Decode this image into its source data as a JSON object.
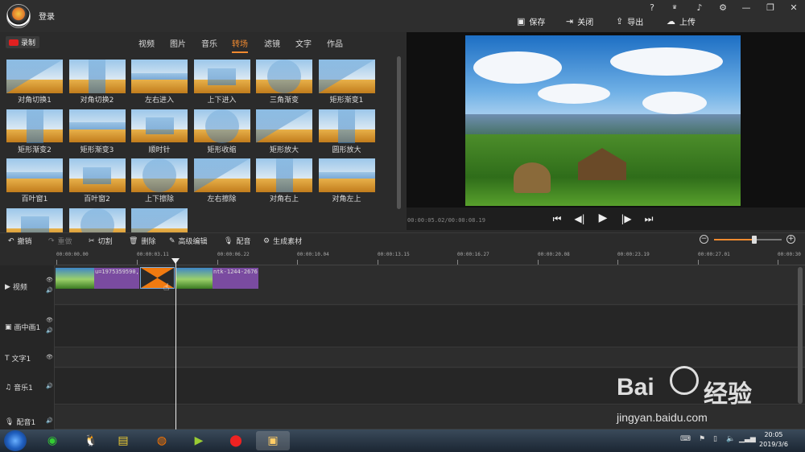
{
  "titlebar": {
    "login": "登录",
    "top_icons": [
      "?",
      "VIP",
      "bell",
      "gear",
      "—",
      "❐",
      "✕"
    ],
    "actions": [
      {
        "icon": "save-icon",
        "label": "保存"
      },
      {
        "icon": "close-project-icon",
        "label": "关闭"
      },
      {
        "icon": "export-icon",
        "label": "导出"
      },
      {
        "icon": "upload-icon",
        "label": "上传"
      }
    ]
  },
  "library": {
    "record_label": "录制",
    "tabs": [
      "视频",
      "图片",
      "音乐",
      "转场",
      "滤镜",
      "文字",
      "作品"
    ],
    "active_tab": "转场",
    "transitions": [
      "对角切换1",
      "对角切换2",
      "左右进入",
      "上下进入",
      "三角渐变",
      "矩形渐变1",
      "矩形渐变2",
      "矩形渐变3",
      "顺时针",
      "矩形收缩",
      "矩形放大",
      "圆形放大",
      "百叶窗1",
      "百叶窗2",
      "上下擦除",
      "左右擦除",
      "对角右上",
      "对角左上",
      "",
      "",
      ""
    ]
  },
  "preview": {
    "timecode": "00:00:05.02/00:00:08.19",
    "controls": [
      "⏮",
      "◀|",
      "▶",
      "|▶",
      "⏭"
    ]
  },
  "edit_toolbar": {
    "items": [
      {
        "label": "撤销",
        "enabled": true
      },
      {
        "label": "重做",
        "enabled": false
      },
      {
        "label": "切割",
        "enabled": true
      },
      {
        "label": "删除",
        "enabled": true
      },
      {
        "label": "高级编辑",
        "enabled": true
      },
      {
        "label": "配音",
        "enabled": true
      },
      {
        "label": "生成素材",
        "enabled": true
      }
    ],
    "zoom_level": 0.6
  },
  "timeline": {
    "ruler": [
      "00:00:00.00",
      "00:00:03.11",
      "00:00:06.22",
      "00:00:10.04",
      "00:00:13.15",
      "00:00:16.27",
      "00:00:20.08",
      "00:00:23.19",
      "00:00:27.01",
      "00:00:30"
    ],
    "tracks": [
      "视频",
      "画中画1",
      "文字1",
      "音乐1",
      "配音1"
    ],
    "clips": [
      {
        "name": "u=1975359590,"
      },
      {
        "name": "ntk-1244-2676"
      }
    ]
  },
  "taskbar": {
    "time": "20:05",
    "date": "2019/3/6"
  },
  "watermark": {
    "brand_left": "Bai",
    "brand_right": "经验",
    "url": "jingyan.baidu.com"
  }
}
